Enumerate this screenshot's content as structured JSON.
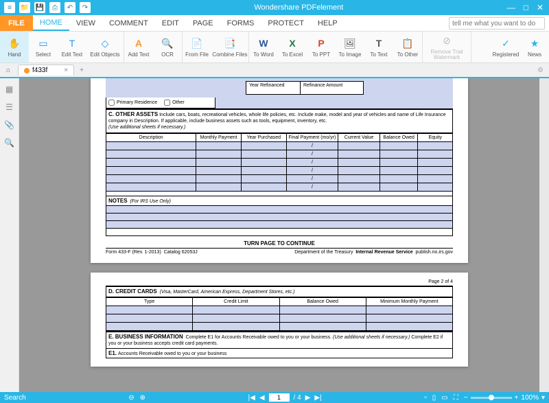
{
  "app": {
    "title": "Wondershare PDFelement"
  },
  "menu": {
    "file": "FILE",
    "items": [
      "HOME",
      "VIEW",
      "COMMENT",
      "EDIT",
      "PAGE",
      "FORMS",
      "PROTECT",
      "HELP"
    ],
    "tellme_placeholder": "tell me what you want to do"
  },
  "ribbon": {
    "hand": "Hand",
    "select": "Select",
    "edit_text": "Edit Text",
    "edit_objects": "Edit Objects",
    "add_text": "Add Text",
    "ocr": "OCR",
    "from_file": "From File",
    "combine_files": "Combine Files",
    "to_word": "To Word",
    "to_excel": "To Excel",
    "to_ppt": "To PPT",
    "to_image": "To Image",
    "to_text": "To Text",
    "to_other": "To Other",
    "remove_wm": "Remove Trial Watermark",
    "registered": "Registered",
    "news": "News"
  },
  "tabs": {
    "doc_name": "f433f",
    "close": "×",
    "plus": "+"
  },
  "form": {
    "refin_date_label": "Year Refinanced",
    "refin_amount_label": "Refinance Amount",
    "primary_residence": "Primary Residence",
    "other": "Other",
    "section_c_title": "C. OTHER ASSETS",
    "section_c_body": "Include cars, boats, recreational vehicles, whole life policies, etc. Include make, model and year of vehicles and name of Life Insurance company in Description. If applicable, include business assets such as tools, equipment, inventory, etc.",
    "section_c_italic": "(Use additional sheets if necessary.)",
    "cols": {
      "desc": "Description",
      "monthly": "Monthly Payment",
      "year_p": "Year Purchased",
      "final": "Final Payment (mo/yr)",
      "current": "Current Value",
      "balance": "Balance Owed",
      "equity": "Equity"
    },
    "notes_title": "NOTES",
    "notes_sub": "(For IRS Use Only)",
    "turn_page": "TURN PAGE TO CONTINUE",
    "footer": {
      "form_no": "Form 433-F (Rev. 1-2013)",
      "catalog": "Catalog 62053J",
      "dept": "Department of the Treasury",
      "irs": "Internal Revenue Service",
      "url": "publish.no.irs.gov"
    },
    "page2of4": "Page 2 of 4",
    "section_d_title": "D. CREDIT CARDS",
    "section_d_sub": "(Visa, MasterCard, American Express, Department Stores, etc.)",
    "credit_cols": {
      "type": "Type",
      "limit": "Credit Limit",
      "balance": "Balance Owed",
      "min": "Minimum Monthly Payment"
    },
    "section_e_title": "E. BUSINESS INFORMATION",
    "section_e_body": "Complete E1 for Accounts Receivable owed to you or your business.",
    "section_e_italic": "(Use additional sheets if necessary.)",
    "section_e_body2": "Complete E2 if you or your business accepts credit card payments.",
    "e1": "E1.",
    "e1_text": "Accounts Receivable owed to you or your business"
  },
  "status": {
    "search": "Search",
    "page_current": "1",
    "page_total": "/ 4",
    "zoom": "100%"
  }
}
